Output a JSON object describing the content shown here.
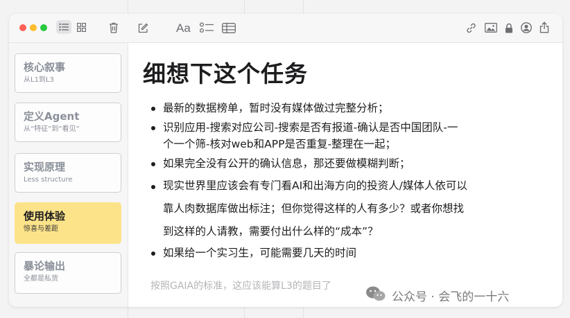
{
  "toolbar": {
    "font_button_label": "Aa"
  },
  "sidebar": {
    "items": [
      {
        "title": "核心叙事",
        "subtitle": "从L1到L3"
      },
      {
        "title": "定义Agent",
        "subtitle": "从“特征”到“看见”"
      },
      {
        "title": "实现原理",
        "subtitle": "Less structure"
      },
      {
        "title": "使用体验",
        "subtitle": "惊喜与差距"
      },
      {
        "title": "暴论输出",
        "subtitle": "全都是私货"
      }
    ],
    "active_index": 3
  },
  "note": {
    "title": "细想下这个任务",
    "bullets": [
      "最新的数据榜单，暂时没有媒体做过完整分析；",
      "识别应用-搜索对应公司-搜索是否有报道-确认是否中国团队-一个一个筛-核对web和APP是否重复-整理在一起；",
      "如果完全没有公开的确认信息，那还要做模糊判断；",
      "现实世界里应该会有专门看AI和出海方向的投资人/媒体人依可以靠人肉数据库做出标注；但你觉得这样的人有多少？或者你想找到这样的人请教，需要付出什么样的“成本”？",
      "如果给一个实习生，可能需要几天的时间"
    ],
    "faded_text": "按照GAIA的标准，这应该能算L3的题目了"
  },
  "watermark": {
    "text": "公众号 · 会飞的一十六"
  },
  "colors": {
    "active_card": "#fce38a",
    "close": "#fe5f57",
    "minimize": "#febc2e",
    "zoom": "#28c840"
  },
  "icons": [
    "list-view-icon",
    "gallery-view-icon",
    "trash-icon",
    "compose-icon",
    "checklist-icon",
    "table-icon",
    "link-icon",
    "media-icon",
    "lock-icon",
    "collaborate-icon",
    "share-icon"
  ]
}
